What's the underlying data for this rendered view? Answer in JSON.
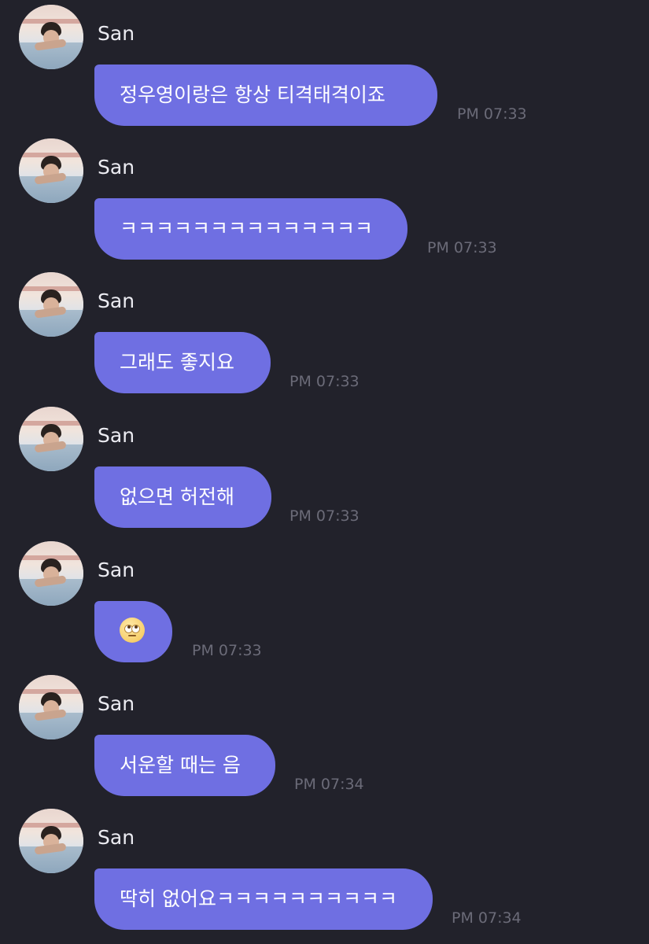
{
  "colors": {
    "background": "#22222b",
    "bubble": "#6f6fe2",
    "bubble_text": "#ffffff",
    "name_text": "#ececf2",
    "time_text": "#6b6b78"
  },
  "messages": [
    {
      "sender": "San",
      "text": "정우영이랑은 항상 티격태격이죠",
      "time": "PM 07:33"
    },
    {
      "sender": "San",
      "text": "ㅋㅋㅋㅋㅋㅋㅋㅋㅋㅋㅋㅋㅋㅋ",
      "time": "PM 07:33"
    },
    {
      "sender": "San",
      "text": "그래도 좋지요",
      "time": "PM 07:33"
    },
    {
      "sender": "San",
      "text": "없으면 허전해",
      "time": "PM 07:33"
    },
    {
      "sender": "San",
      "icon": "rolling-eyes-emoji-icon",
      "time": "PM 07:33"
    },
    {
      "sender": "San",
      "text": "서운할 때는 음",
      "time": "PM 07:34"
    },
    {
      "sender": "San",
      "text": "딱히 없어요ㅋㅋㅋㅋㅋㅋㅋㅋㅋㅋ",
      "time": "PM 07:34"
    }
  ]
}
